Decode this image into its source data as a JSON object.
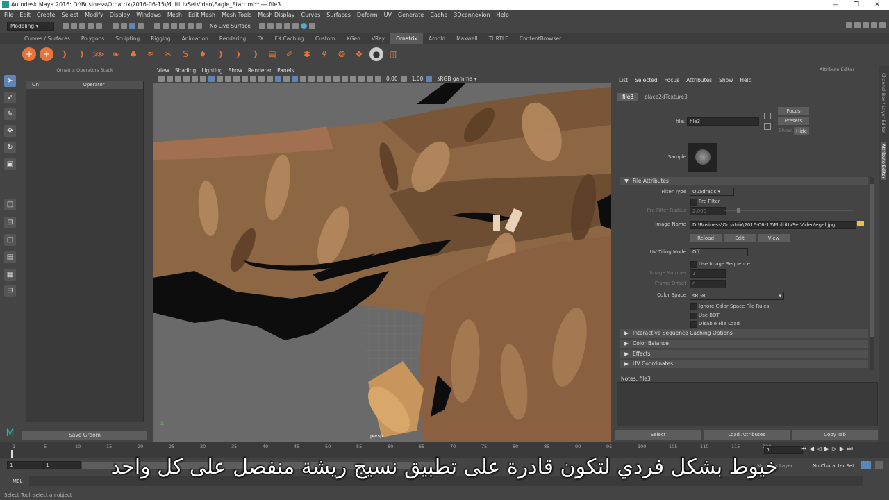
{
  "window": {
    "title": "Autodesk Maya 2016: D:\\Business\\Ornatrix\\2016-06-15\\MultiUvSetVideo\\Eagle_Start.mb*  ---  file3"
  },
  "menubar": [
    "File",
    "Edit",
    "Create",
    "Select",
    "Modify",
    "Display",
    "Windows",
    "Mesh",
    "Edit Mesh",
    "Mesh Tools",
    "Mesh Display",
    "Curves",
    "Surfaces",
    "Deform",
    "UV",
    "Generate",
    "Cache",
    "3Dconnexion",
    "Help"
  ],
  "statusline": {
    "mode": "Modeling",
    "live_surface": "No Live Surface"
  },
  "shelf_tabs": [
    "Curves / Surfaces",
    "Polygons",
    "Sculpting",
    "Rigging",
    "Animation",
    "Rendering",
    "FX",
    "FX Caching",
    "Custom",
    "XGen",
    "VRay",
    "Ornatrix",
    "Arnold",
    "Maxwell",
    "TURTLE",
    "ContentBrowser"
  ],
  "shelf_active": "Ornatrix",
  "ornatrix_panel": {
    "title": "Ornatrix Operators Stack",
    "col_on": "On",
    "col_operator": "Operator",
    "save_button": "Save Groom"
  },
  "viewport": {
    "menu": [
      "View",
      "Shading",
      "Lighting",
      "Show",
      "Renderer",
      "Panels"
    ],
    "exposure": "0.00",
    "gamma": "1.00",
    "color_space": "sRGB gamma",
    "camera": "persp"
  },
  "attribute_editor": {
    "title": "Attribute Editor",
    "menu": [
      "List",
      "Selected",
      "Focus",
      "Attributes",
      "Show",
      "Help"
    ],
    "tabs": [
      "file3",
      "place2dTexture3"
    ],
    "file_label": "file:",
    "file_value": "file3",
    "focus_button": "Focus",
    "presets_button": "Presets",
    "show_label": "Show",
    "hide_button": "Hide",
    "sample_label": "Sample",
    "section_file_attributes": "File Attributes",
    "filter_type_label": "Filter Type",
    "filter_type_value": "Quadratic",
    "pre_filter_label": "Pre Filter",
    "pre_filter_radius_label": "Pre Filter Radius",
    "pre_filter_radius_value": "2.000",
    "image_name_label": "Image Name",
    "image_name_value": "D:\\Business\\Ornatrix\\2016-06-15\\MultiUvSetVideo\\egel.jpg",
    "reload_button": "Reload",
    "edit_button": "Edit",
    "view_button": "View",
    "uv_tiling_label": "UV Tiling Mode",
    "uv_tiling_value": "Off",
    "use_image_sequence": "Use Image Sequence",
    "image_number_label": "Image Number",
    "image_number_value": "1",
    "frame_offset_label": "Frame Offset",
    "frame_offset_value": "0",
    "color_space_label": "Color Space",
    "color_space_value": "sRGB",
    "ignore_color_space": "Ignore Color Space File Rules",
    "use_bot": "Use BOT",
    "disable_file_load": "Disable File Load",
    "sections": [
      "Interactive Sequence Caching Options",
      "Color Balance",
      "Effects",
      "UV Coordinates"
    ],
    "notes_label": "Notes:  file3",
    "select_button": "Select",
    "load_attributes_button": "Load Attributes",
    "copy_tab_button": "Copy Tab"
  },
  "right_strip": {
    "channel_box": "Channel Box / Layer Editor",
    "attribute_editor": "Attribute Editor"
  },
  "timeline": {
    "ticks": [
      "1",
      "5",
      "10",
      "15",
      "20",
      "25",
      "30",
      "35",
      "40",
      "45",
      "50",
      "55",
      "60",
      "65",
      "70",
      "75",
      "80",
      "85",
      "90",
      "95",
      "100",
      "105",
      "110",
      "115",
      "120"
    ],
    "current_frame": "1",
    "range_start": "1",
    "range_start2": "1",
    "anim_layer": "No Anim Layer",
    "char_set": "No Character Set"
  },
  "command": {
    "lang": "MEL",
    "help": "Select Tool: select an object"
  },
  "subtitle": "خيوط بشكل فردي لتكون قادرة على تطبيق نسيج ريشة منفصل على كل واحد",
  "colors": {
    "accent_active_tab": "#5a5a5a",
    "shelf_orange": "#e8743b",
    "viewport_bg": "#6a6a6a",
    "feather_brown": "#9a6a40"
  }
}
